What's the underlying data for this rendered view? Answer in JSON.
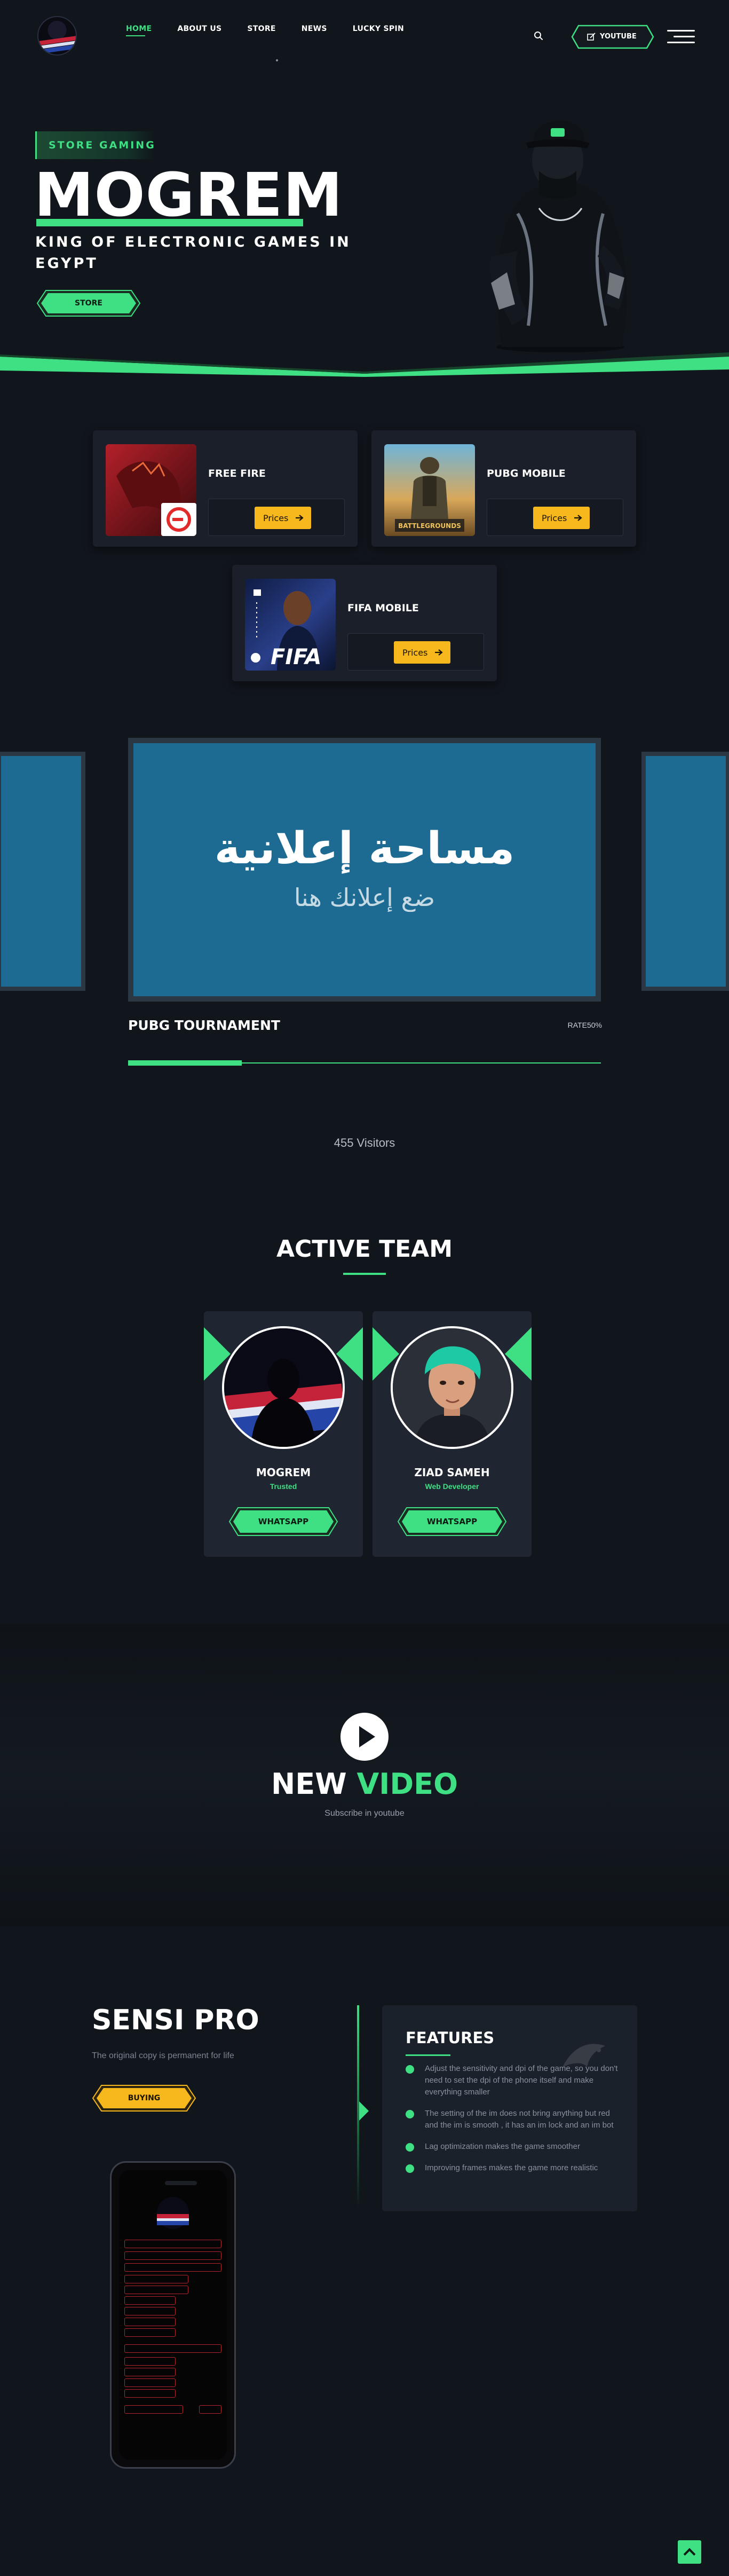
{
  "header": {
    "nav": [
      "HOME",
      "ABOUT US",
      "STORE",
      "NEWS",
      "LUCKY SPIN"
    ],
    "youtube_label": "YOUTUBE",
    "icons": [
      "search-icon",
      "edit-icon",
      "menu-icon"
    ]
  },
  "hero": {
    "tag": "STORE GAMING",
    "title": "MOGREM",
    "subtitle": "KING OF ELECTRONIC GAMES IN EGYPT",
    "cta": "STORE"
  },
  "games": [
    {
      "name": "FREE FIRE",
      "button": "Prices"
    },
    {
      "name": "PUBG MOBILE",
      "button": "Prices"
    },
    {
      "name": "FIFA MOBILE",
      "button": "Prices",
      "thumb_text": "FIFA"
    }
  ],
  "ad": {
    "line1": "مساحة إعلانية",
    "line2": "ضع إعلانك هنا"
  },
  "tournament": {
    "title": "PUBG TOURNAMENT",
    "rate_label": "RATE50%",
    "rate": 0.5
  },
  "visitors": "455 Visitors",
  "team": {
    "title": "ACTIVE TEAM",
    "members": [
      {
        "name": "MOGREM",
        "role": "Trusted",
        "button": "WHATSAPP"
      },
      {
        "name": "ZIAD SAMEH",
        "role": "Web Developer",
        "button": "WHATSAPP"
      }
    ]
  },
  "video": {
    "title_white": "NEW",
    "title_green": "VIDEO",
    "subtitle": "Subscribe in youtube"
  },
  "sensi": {
    "title": "SENSI PRO",
    "subtitle": "The original copy is permanent for life",
    "cta": "BUYING",
    "features_title": "FEATURES",
    "features": [
      "Adjust the sensitivity and dpi of the game, so you don't need to set the dpi of the phone itself and make everything smaller",
      "The setting of the im does not bring anything but red and the im is smooth , it has an im lock and an im bot",
      "Lag optimization makes the game smoother",
      "Improving frames makes the game more realistic"
    ]
  },
  "colors": {
    "accent": "#3ee083",
    "gold": "#f6b81c",
    "background": "#11151c",
    "card": "#1a1f29",
    "ad_blue": "#1d6b93"
  }
}
